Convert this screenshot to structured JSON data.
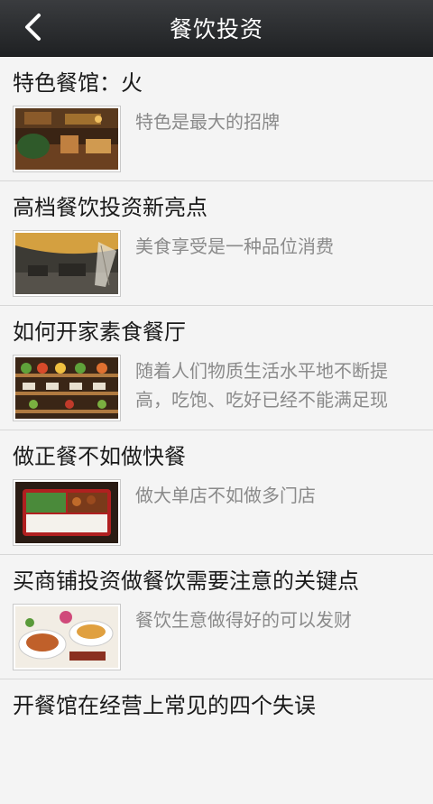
{
  "header": {
    "title": "餐饮投资",
    "back_icon": "chevron-left-icon"
  },
  "articles": [
    {
      "title": "特色餐馆：火",
      "summary": "特色是最大的招牌",
      "thumb": "restaurant-interior-image"
    },
    {
      "title": "高档餐饮投资新亮点",
      "summary": "美食享受是一种品位消费",
      "thumb": "lounge-image"
    },
    {
      "title": "如何开家素食餐厅",
      "summary": "随着人们物质生活水平地不断提高，吃饱、吃好已经不能满足现",
      "thumb": "vegetable-shelf-image"
    },
    {
      "title": "做正餐不如做快餐",
      "summary": "做大单店不如做多门店",
      "thumb": "bento-box-image"
    },
    {
      "title": "买商铺投资做餐饮需要注意的关键点",
      "summary": "餐饮生意做得好的可以发财",
      "thumb": "dishes-image"
    },
    {
      "title": "开餐馆在经营上常见的四个失误",
      "summary": "",
      "thumb": ""
    }
  ],
  "colors": {
    "header_bg": "#2b2d30",
    "title_text": "#1a1a1a",
    "summary_text": "#8a8a8a",
    "page_bg": "#f4f4f4"
  }
}
